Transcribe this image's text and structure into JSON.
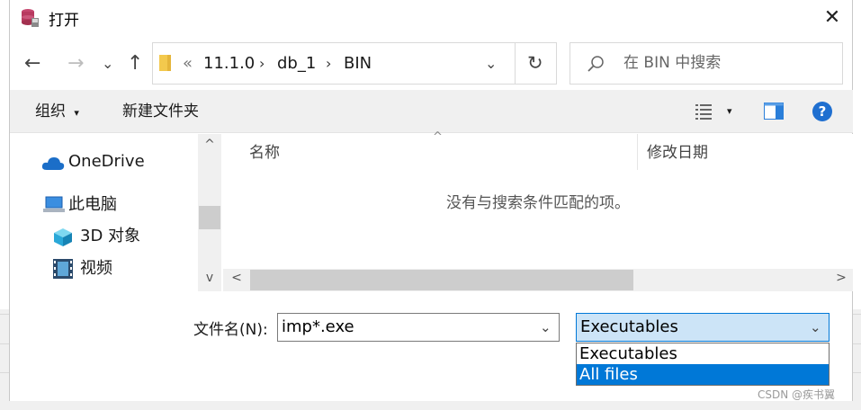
{
  "window": {
    "title": "打开",
    "close_glyph": "✕"
  },
  "navigation": {
    "back_icon": "←",
    "forward_icon": "→",
    "recent_icon": "⌄",
    "up_icon": "↑",
    "breadcrumb_prefix": "«",
    "breadcrumb": [
      "11.1.0",
      "db_1",
      "BIN"
    ],
    "separator": "›",
    "dropdown_icon": "⌄",
    "refresh_icon": "↻"
  },
  "search": {
    "placeholder": "在 BIN 中搜索",
    "icon": "search-icon"
  },
  "toolbar": {
    "organize_label": "组织",
    "organize_arrow": "▾",
    "new_folder_label": "新建文件夹",
    "view_arrow": "▾",
    "help_glyph": "?"
  },
  "sidebar": {
    "items": [
      {
        "label": "OneDrive"
      },
      {
        "label": "此电脑"
      },
      {
        "label": "3D 对象"
      },
      {
        "label": "视频"
      }
    ]
  },
  "file_list": {
    "columns": [
      "名称",
      "修改日期"
    ],
    "sort_indicator": "^",
    "empty_message": "没有与搜索条件匹配的项。"
  },
  "scrollbar": {
    "up": "^",
    "down": "v",
    "left": "<",
    "right": ">"
  },
  "filename": {
    "label": "文件名(N):",
    "value": "imp*.exe",
    "dropdown_icon": "⌄"
  },
  "filetype": {
    "value": "Executables",
    "dropdown_icon": "⌄",
    "options": [
      "Executables",
      "All files"
    ],
    "highlighted_option": "All files"
  },
  "watermark": "CSDN @疾书翼",
  "colors": {
    "accent": "#0078d7",
    "select_bg": "#cce4f7",
    "toolbar_bg": "#f0f0f0",
    "folder": "#f3c94d"
  }
}
